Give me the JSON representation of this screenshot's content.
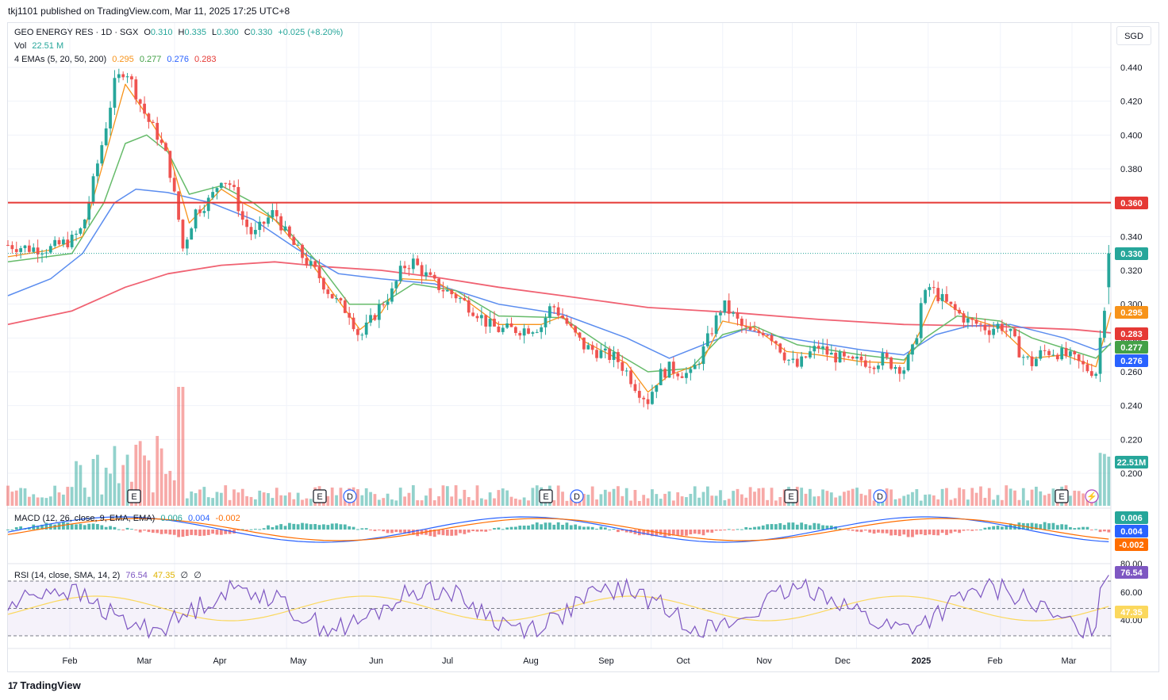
{
  "header": {
    "publisher_line": "tkj1101 published on TradingView.com, Mar 11, 2025 17:25 UTC+8"
  },
  "legend": {
    "symbol": "GEO ENERGY RES · 1D · SGX",
    "o_label": "O",
    "o_value": "0.310",
    "h_label": "H",
    "h_value": "0.335",
    "l_label": "L",
    "l_value": "0.300",
    "c_label": "C",
    "c_value": "0.330",
    "change": "+0.025 (+8.20%)",
    "vol_label": "Vol",
    "vol_value": "22.51 M",
    "ema_label": "4 EMAs (5, 20, 50, 200)",
    "ema5": "0.295",
    "ema20": "0.277",
    "ema50": "0.276",
    "ema200": "0.283",
    "macd_label": "MACD (12, 26, close, 9, EMA, EMA)",
    "macd_line": "0.006",
    "macd_signal": "0.004",
    "macd_hist": "-0.002",
    "rsi_label": "RSI (14, close, SMA, 14, 2)",
    "rsi_value": "76.54",
    "rsi_ma": "47.35",
    "rsi_extra1": "∅",
    "rsi_extra2": "∅"
  },
  "currency": "SGD",
  "price_labels": {
    "resistance": "0.360",
    "last": "0.330",
    "ema5": "0.295",
    "ema200": "0.283",
    "ema20": "0.277",
    "ema50": "0.276",
    "volume": "22.51M",
    "macd_line": "0.006",
    "macd_signal": "0.004",
    "macd_hist": "-0.002",
    "rsi": "76.54",
    "rsi_ma": "47.35"
  },
  "colors": {
    "up": "#26a69a",
    "down": "#ef5350",
    "ema5": "#f7931a",
    "ema20": "#66bb6a",
    "ema50": "#5b8def",
    "ema200": "#f06272",
    "resistance": "#e53935",
    "macd": "#2962ff",
    "signal": "#ff6d00",
    "rsi": "#7e57c2",
    "rsi_ma": "#fbd85d"
  },
  "event_markers": {
    "earnings": "E",
    "dividend": "D",
    "flash": "⚡"
  },
  "brand": "TradingView",
  "chart_data": {
    "type": "candlestick",
    "x_tick_labels": [
      "Feb",
      "Mar",
      "Apr",
      "May",
      "Jun",
      "Jul",
      "Aug",
      "Sep",
      "Oct",
      "Nov",
      "Dec",
      "2025",
      "Feb",
      "Mar"
    ],
    "y_tick_labels": [
      "0.440",
      "0.420",
      "0.400",
      "0.380",
      "0.360",
      "0.340",
      "0.320",
      "0.300",
      "0.280",
      "0.260",
      "0.240",
      "0.220",
      "0.200"
    ],
    "price_ylim": [
      0.195,
      0.45
    ],
    "resistance_level": 0.36,
    "last_close": 0.33,
    "close_path": [
      [
        0,
        0.335
      ],
      [
        10,
        0.333
      ],
      [
        20,
        0.333
      ],
      [
        30,
        0.338
      ],
      [
        35,
        0.345
      ],
      [
        40,
        0.372
      ],
      [
        45,
        0.4
      ],
      [
        50,
        0.43
      ],
      [
        55,
        0.44
      ],
      [
        60,
        0.425
      ],
      [
        65,
        0.41
      ],
      [
        70,
        0.4
      ],
      [
        75,
        0.385
      ],
      [
        80,
        0.35
      ],
      [
        82,
        0.333
      ],
      [
        88,
        0.355
      ],
      [
        95,
        0.362
      ],
      [
        100,
        0.375
      ],
      [
        105,
        0.37
      ],
      [
        110,
        0.35
      ],
      [
        115,
        0.34
      ],
      [
        120,
        0.348
      ],
      [
        125,
        0.355
      ],
      [
        130,
        0.342
      ],
      [
        135,
        0.333
      ],
      [
        140,
        0.325
      ],
      [
        145,
        0.318
      ],
      [
        150,
        0.308
      ],
      [
        155,
        0.3
      ],
      [
        160,
        0.295
      ],
      [
        165,
        0.28
      ],
      [
        170,
        0.29
      ],
      [
        175,
        0.3
      ],
      [
        180,
        0.307
      ],
      [
        185,
        0.322
      ],
      [
        190,
        0.325
      ],
      [
        195,
        0.318
      ],
      [
        200,
        0.312
      ],
      [
        205,
        0.308
      ],
      [
        210,
        0.305
      ],
      [
        215,
        0.3
      ],
      [
        220,
        0.295
      ],
      [
        225,
        0.288
      ],
      [
        230,
        0.285
      ],
      [
        240,
        0.285
      ],
      [
        250,
        0.287
      ],
      [
        255,
        0.3
      ],
      [
        260,
        0.292
      ],
      [
        265,
        0.283
      ],
      [
        270,
        0.275
      ],
      [
        280,
        0.27
      ],
      [
        285,
        0.268
      ],
      [
        290,
        0.26
      ],
      [
        295,
        0.25
      ],
      [
        300,
        0.243
      ],
      [
        305,
        0.258
      ],
      [
        310,
        0.262
      ],
      [
        320,
        0.258
      ],
      [
        325,
        0.27
      ],
      [
        330,
        0.285
      ],
      [
        335,
        0.3
      ],
      [
        340,
        0.293
      ],
      [
        345,
        0.285
      ],
      [
        350,
        0.282
      ],
      [
        355,
        0.285
      ],
      [
        360,
        0.278
      ],
      [
        365,
        0.268
      ],
      [
        370,
        0.263
      ],
      [
        375,
        0.27
      ],
      [
        380,
        0.275
      ],
      [
        385,
        0.27
      ],
      [
        390,
        0.268
      ],
      [
        395,
        0.265
      ],
      [
        400,
        0.267
      ],
      [
        405,
        0.265
      ],
      [
        410,
        0.268
      ],
      [
        415,
        0.264
      ],
      [
        420,
        0.262
      ],
      [
        425,
        0.275
      ],
      [
        428,
        0.3
      ],
      [
        432,
        0.31
      ],
      [
        436,
        0.305
      ],
      [
        440,
        0.3
      ],
      [
        445,
        0.295
      ],
      [
        450,
        0.29
      ],
      [
        455,
        0.288
      ],
      [
        460,
        0.285
      ],
      [
        465,
        0.288
      ],
      [
        470,
        0.282
      ],
      [
        475,
        0.27
      ],
      [
        480,
        0.265
      ],
      [
        485,
        0.272
      ],
      [
        490,
        0.272
      ],
      [
        495,
        0.27
      ],
      [
        500,
        0.267
      ],
      [
        505,
        0.262
      ],
      [
        510,
        0.26
      ],
      [
        514,
        0.3
      ],
      [
        517,
        0.33
      ]
    ],
    "ema5_path": [
      [
        0,
        0.328
      ],
      [
        20,
        0.332
      ],
      [
        35,
        0.34
      ],
      [
        45,
        0.385
      ],
      [
        55,
        0.43
      ],
      [
        65,
        0.412
      ],
      [
        75,
        0.392
      ],
      [
        85,
        0.348
      ],
      [
        100,
        0.368
      ],
      [
        110,
        0.36
      ],
      [
        125,
        0.35
      ],
      [
        140,
        0.328
      ],
      [
        155,
        0.302
      ],
      [
        165,
        0.285
      ],
      [
        175,
        0.295
      ],
      [
        185,
        0.315
      ],
      [
        200,
        0.314
      ],
      [
        215,
        0.302
      ],
      [
        230,
        0.288
      ],
      [
        250,
        0.288
      ],
      [
        260,
        0.293
      ],
      [
        270,
        0.278
      ],
      [
        290,
        0.265
      ],
      [
        300,
        0.248
      ],
      [
        310,
        0.258
      ],
      [
        325,
        0.265
      ],
      [
        335,
        0.29
      ],
      [
        350,
        0.286
      ],
      [
        365,
        0.272
      ],
      [
        380,
        0.27
      ],
      [
        400,
        0.266
      ],
      [
        420,
        0.265
      ],
      [
        428,
        0.285
      ],
      [
        435,
        0.305
      ],
      [
        450,
        0.292
      ],
      [
        465,
        0.286
      ],
      [
        480,
        0.268
      ],
      [
        495,
        0.27
      ],
      [
        510,
        0.263
      ],
      [
        517,
        0.295
      ]
    ],
    "ema20_path": [
      [
        0,
        0.325
      ],
      [
        30,
        0.33
      ],
      [
        45,
        0.36
      ],
      [
        55,
        0.395
      ],
      [
        65,
        0.4
      ],
      [
        75,
        0.39
      ],
      [
        85,
        0.365
      ],
      [
        100,
        0.37
      ],
      [
        115,
        0.36
      ],
      [
        130,
        0.345
      ],
      [
        145,
        0.325
      ],
      [
        160,
        0.3
      ],
      [
        175,
        0.3
      ],
      [
        190,
        0.312
      ],
      [
        210,
        0.308
      ],
      [
        230,
        0.293
      ],
      [
        260,
        0.292
      ],
      [
        280,
        0.275
      ],
      [
        300,
        0.26
      ],
      [
        320,
        0.262
      ],
      [
        335,
        0.282
      ],
      [
        350,
        0.287
      ],
      [
        370,
        0.276
      ],
      [
        400,
        0.27
      ],
      [
        420,
        0.267
      ],
      [
        430,
        0.28
      ],
      [
        445,
        0.293
      ],
      [
        465,
        0.29
      ],
      [
        480,
        0.28
      ],
      [
        500,
        0.272
      ],
      [
        510,
        0.268
      ],
      [
        517,
        0.277
      ]
    ],
    "ema50_path": [
      [
        0,
        0.305
      ],
      [
        20,
        0.315
      ],
      [
        35,
        0.33
      ],
      [
        50,
        0.36
      ],
      [
        60,
        0.368
      ],
      [
        75,
        0.366
      ],
      [
        95,
        0.36
      ],
      [
        115,
        0.35
      ],
      [
        135,
        0.333
      ],
      [
        155,
        0.318
      ],
      [
        175,
        0.315
      ],
      [
        200,
        0.312
      ],
      [
        230,
        0.3
      ],
      [
        260,
        0.294
      ],
      [
        290,
        0.28
      ],
      [
        310,
        0.268
      ],
      [
        330,
        0.278
      ],
      [
        345,
        0.285
      ],
      [
        365,
        0.28
      ],
      [
        400,
        0.273
      ],
      [
        420,
        0.27
      ],
      [
        435,
        0.282
      ],
      [
        450,
        0.287
      ],
      [
        470,
        0.288
      ],
      [
        495,
        0.28
      ],
      [
        510,
        0.273
      ],
      [
        517,
        0.276
      ]
    ],
    "ema200_path": [
      [
        0,
        0.288
      ],
      [
        30,
        0.296
      ],
      [
        55,
        0.31
      ],
      [
        75,
        0.318
      ],
      [
        100,
        0.323
      ],
      [
        125,
        0.325
      ],
      [
        150,
        0.322
      ],
      [
        175,
        0.32
      ],
      [
        200,
        0.316
      ],
      [
        230,
        0.31
      ],
      [
        260,
        0.305
      ],
      [
        300,
        0.298
      ],
      [
        340,
        0.295
      ],
      [
        380,
        0.291
      ],
      [
        420,
        0.288
      ],
      [
        460,
        0.287
      ],
      [
        500,
        0.285
      ],
      [
        517,
        0.283
      ]
    ],
    "volume_last_millions": 22.51,
    "macd_values": {
      "macd": 0.006,
      "signal": 0.004,
      "histogram": -0.002
    },
    "rsi": {
      "value": 76.54,
      "ma": 47.35,
      "bands": [
        30,
        70
      ],
      "y_tick_labels": [
        "80.00",
        "60.00",
        "40.00"
      ]
    }
  }
}
